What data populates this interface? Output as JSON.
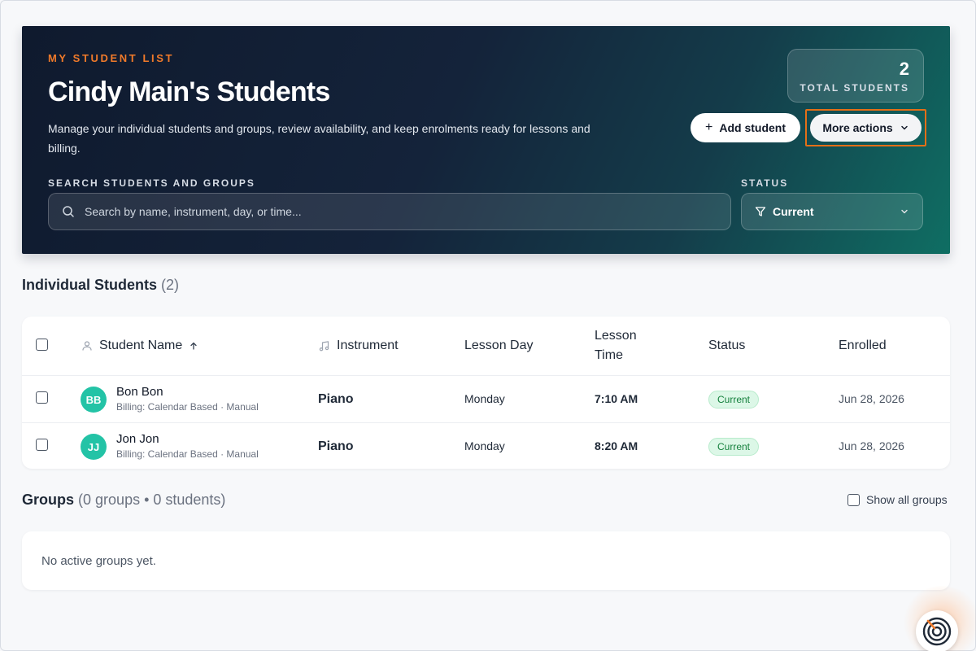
{
  "hero": {
    "eyebrow": "MY STUDENT LIST",
    "title": "Cindy Main's Students",
    "description": "Manage your individual students and groups, review availability, and keep enrolments ready for lessons and billing.",
    "total_count": "2",
    "total_label": "TOTAL STUDENTS",
    "add_label": "Add student",
    "more_label": "More actions",
    "search_label": "SEARCH STUDENTS AND GROUPS",
    "search_placeholder": "Search by name, instrument, day, or time...",
    "status_label": "STATUS",
    "status_value": "Current"
  },
  "individual": {
    "title": "Individual Students",
    "count": "(2)",
    "columns": {
      "name": "Student Name",
      "instrument": "Instrument",
      "day": "Lesson Day",
      "time_line1": "Lesson",
      "time_line2": "Time",
      "status": "Status",
      "enrolled": "Enrolled"
    },
    "rows": [
      {
        "initials": "BB",
        "name": "Bon Bon",
        "billing": "Billing: Calendar Based · Manual",
        "instrument": "Piano",
        "day": "Monday",
        "time": "7:10 AM",
        "status": "Current",
        "enrolled": "Jun 28, 2026"
      },
      {
        "initials": "JJ",
        "name": "Jon Jon",
        "billing": "Billing: Calendar Based · Manual",
        "instrument": "Piano",
        "day": "Monday",
        "time": "8:20 AM",
        "status": "Current",
        "enrolled": "Jun 28, 2026"
      }
    ]
  },
  "groups": {
    "title": "Groups",
    "summary": "(0 groups • 0 students)",
    "show_all_label": "Show all groups",
    "empty_text": "No active groups yet."
  },
  "colors": {
    "accent": "#f07a2a",
    "avatar": "#23c3a6",
    "badge_bg": "#dcf7e7",
    "badge_text": "#15803d",
    "highlight": "#e46f17"
  },
  "icons": {
    "plus": "plus-icon",
    "chevron": "chevron-down-icon",
    "search": "search-icon",
    "filter": "filter-icon",
    "user": "user-icon",
    "sort": "arrow-up-icon",
    "music": "music-note-icon",
    "help": "assistant-ring-icon"
  }
}
